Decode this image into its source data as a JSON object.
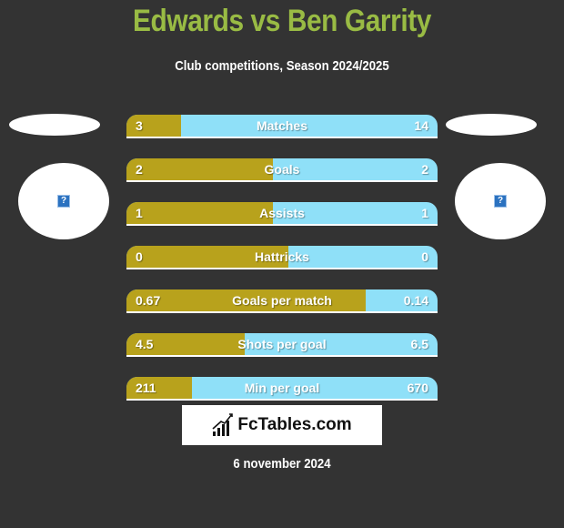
{
  "header": {
    "title": "Edwards vs Ben Garrity",
    "subtitle": "Club competitions, Season 2024/2025"
  },
  "players": {
    "left": {
      "avatar_icon": "broken-image-icon",
      "glyph": "?"
    },
    "right": {
      "avatar_icon": "broken-image-icon",
      "glyph": "?"
    }
  },
  "colors": {
    "left": "#b8a21c",
    "right": "#8fe0f8",
    "title": "#99bb44",
    "background": "#333333"
  },
  "stats": [
    {
      "label": "Matches",
      "left": "3",
      "right": "14",
      "left_share": 0.175
    },
    {
      "label": "Goals",
      "left": "2",
      "right": "2",
      "left_share": 0.47
    },
    {
      "label": "Assists",
      "left": "1",
      "right": "1",
      "left_share": 0.47
    },
    {
      "label": "Hattricks",
      "left": "0",
      "right": "0",
      "left_share": 0.52
    },
    {
      "label": "Goals per match",
      "left": "0.67",
      "right": "0.14",
      "left_share": 0.77
    },
    {
      "label": "Shots per goal",
      "left": "4.5",
      "right": "6.5",
      "left_share": 0.38
    },
    {
      "label": "Min per goal",
      "left": "211",
      "right": "670",
      "left_share": 0.21
    }
  ],
  "footer": {
    "brand": "FcTables.com",
    "brand_icon": "bar-chart-icon",
    "date": "6 november 2024"
  }
}
